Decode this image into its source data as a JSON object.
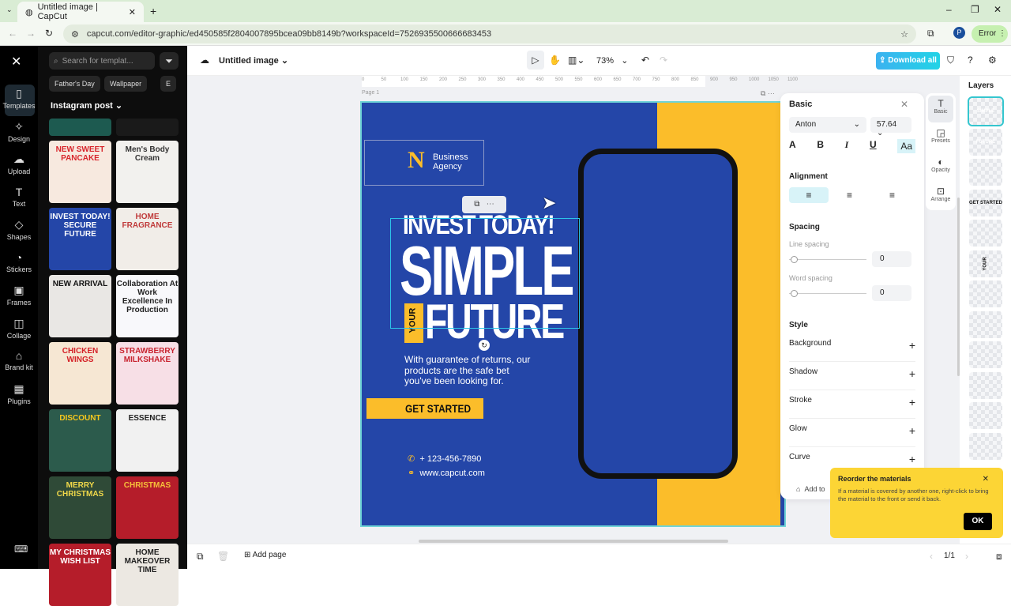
{
  "browser": {
    "tab_title": "Untitled image | CapCut",
    "url": "capcut.com/editor-graphic/ed450585f2804007895bcea09bb8149b?workspaceId=7526935500666683453",
    "profile": "P",
    "error_label": "Error"
  },
  "rail": [
    {
      "label": "Templates",
      "icon": "▯"
    },
    {
      "label": "Design",
      "icon": "✧"
    },
    {
      "label": "Upload",
      "icon": "☁"
    },
    {
      "label": "Text",
      "icon": "T"
    },
    {
      "label": "Shapes",
      "icon": "◇"
    },
    {
      "label": "Stickers",
      "icon": "◔"
    },
    {
      "label": "Frames",
      "icon": "▣"
    },
    {
      "label": "Collage",
      "icon": "◫"
    },
    {
      "label": "Brand kit",
      "icon": "⌂"
    },
    {
      "label": "Plugins",
      "icon": "▦"
    }
  ],
  "panel": {
    "search_placeholder": "Search for templat...",
    "chips": [
      "Father's Day",
      "Wallpaper",
      "E"
    ],
    "category": "Instagram post",
    "templates": [
      {
        "title": "",
        "bg": "#1d5a50",
        "fg": "#fff"
      },
      {
        "title": "",
        "bg": "#1a1a1a",
        "fg": "#fff"
      },
      {
        "title": "NEW SWEET PANCAKE",
        "bg": "#f7e9df",
        "fg": "#d8262c"
      },
      {
        "title": "Men's Body Cream",
        "bg": "#f2f1ee",
        "fg": "#333"
      },
      {
        "title": "INVEST TODAY! SECURE FUTURE",
        "bg": "#2446a8",
        "fg": "#fff"
      },
      {
        "title": "HOME FRAGRANCE",
        "bg": "#f1ede8",
        "fg": "#c03b3b"
      },
      {
        "title": "NEW ARRIVAL",
        "bg": "#e9e7e4",
        "fg": "#111"
      },
      {
        "title": "Collaboration At Work Excellence In Production",
        "bg": "#f8f8fb",
        "fg": "#222"
      },
      {
        "title": "CHICKEN WINGS",
        "bg": "#f6e7d3",
        "fg": "#d42127"
      },
      {
        "title": "STRAWBERRY MILKSHAKE",
        "bg": "#f7dfe6",
        "fg": "#c8232f"
      },
      {
        "title": "DISCOUNT",
        "bg": "#2c5b4c",
        "fg": "#f7c71d"
      },
      {
        "title": "ESSENCE",
        "bg": "#f1f1f1",
        "fg": "#222"
      },
      {
        "title": "MERRY CHRISTMAS",
        "bg": "#2f4a37",
        "fg": "#f0d84a"
      },
      {
        "title": "CHRISTMAS",
        "bg": "#b51d2a",
        "fg": "#f6c03a"
      },
      {
        "title": "MY CHRISTMAS WISH LIST",
        "bg": "#b51d2a",
        "fg": "#fff"
      },
      {
        "title": "HOME MAKEOVER TIME",
        "bg": "#ece8e2",
        "fg": "#222"
      }
    ]
  },
  "toolbar": {
    "doc_title": "Untitled image",
    "zoom": "73%",
    "download": "Download all"
  },
  "ruler": [
    "0",
    "50",
    "100",
    "150",
    "200",
    "250",
    "300",
    "350",
    "400",
    "450",
    "500",
    "550",
    "600",
    "650",
    "700",
    "750",
    "800",
    "850",
    "900",
    "950",
    "1000",
    "1050",
    "1100"
  ],
  "canvas": {
    "page_label": "Page 1",
    "brand": "Business Agency",
    "headline1": "INVEST TODAY!",
    "headline2": "SIMPLE",
    "your": "YOUR",
    "headline3": "FUTURE",
    "body": "With guarantee of returns, our products are the safe bet you've been looking for.",
    "cta": "GET STARTED",
    "phone": "+ 123-456-7890",
    "website": "www.capcut.com",
    "colors": {
      "blue": "#2446a8",
      "yellow": "#fbbd2a"
    }
  },
  "props": {
    "title": "Basic",
    "font": "Anton",
    "size": "57.64",
    "alignment": "Alignment",
    "spacing": "Spacing",
    "line_spacing": "Line spacing",
    "line_value": "0",
    "word_spacing": "Word spacing",
    "word_value": "0",
    "style": "Style",
    "style_items": [
      "Background",
      "Shadow",
      "Stroke",
      "Glow",
      "Curve"
    ],
    "add_to": "Add to"
  },
  "sidetabs": [
    "Basic",
    "Presets",
    "Opacity",
    "Arrange"
  ],
  "layers": {
    "title": "Layers",
    "items": [
      "SIMPLE",
      "FUTURE",
      "",
      "GET STARTED",
      "",
      "YOUR",
      "",
      "",
      "",
      "",
      "",
      ""
    ]
  },
  "toast": {
    "title": "Reorder the materials",
    "body": "If a material is covered by another one, right-click to bring the material to the front or send it back.",
    "ok": "OK"
  },
  "bottom": {
    "add_page": "Add page",
    "pages": "1/1"
  }
}
